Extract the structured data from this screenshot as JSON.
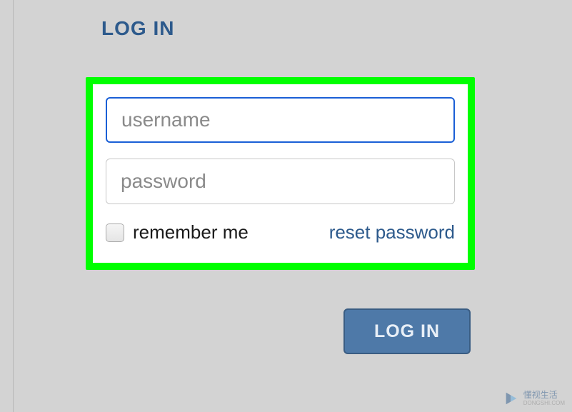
{
  "header": {
    "title": "LOG IN"
  },
  "form": {
    "username": {
      "placeholder": "username",
      "value": ""
    },
    "password": {
      "placeholder": "password",
      "value": ""
    },
    "remember_label": "remember me",
    "reset_link": "reset password"
  },
  "actions": {
    "login_button": "LOG IN"
  },
  "watermark": {
    "text": "懂视生活",
    "sub": "DONGSHI.COM"
  },
  "colors": {
    "accent": "#2d5a8c",
    "highlight": "#00ff00",
    "button_bg": "#4e79a8",
    "focus_border": "#1a5fd6"
  }
}
